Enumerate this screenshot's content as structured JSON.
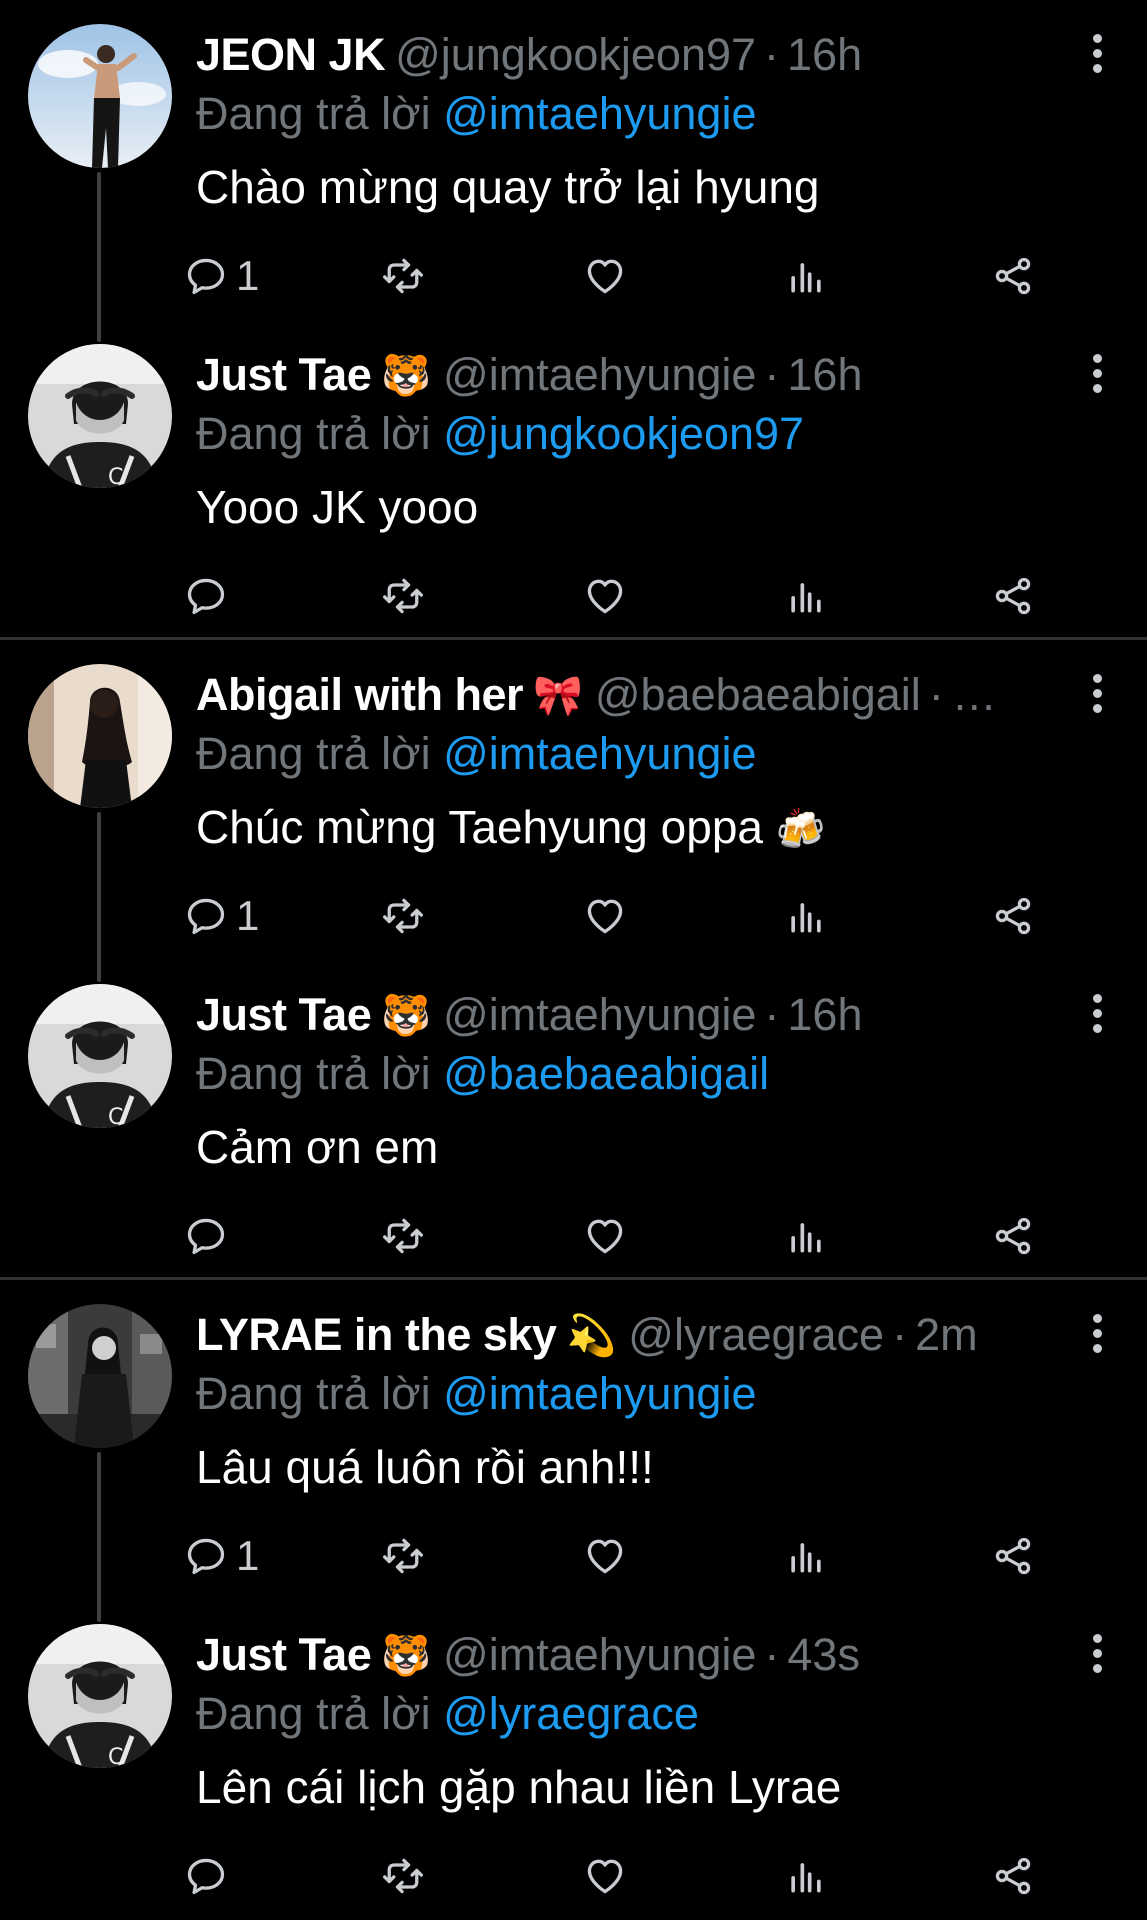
{
  "reply_label": "Đang trả lời",
  "threads": [
    {
      "tweets": [
        {
          "name": "JEON JK",
          "emoji": "",
          "handle": "@jungkookjeon97",
          "time": "16h",
          "reply_to": "@imtaehyungie",
          "text": "Chào mừng quay trở lại hyung",
          "text_emoji": "",
          "replies": "1",
          "avatar": "sky"
        },
        {
          "name": "Just Tae",
          "emoji": "🐯",
          "handle": "@imtaehyungie",
          "time": "16h",
          "reply_to": "@jungkookjeon97",
          "text": "Yooo JK yooo",
          "text_emoji": "",
          "replies": "",
          "avatar": "bw"
        }
      ]
    },
    {
      "tweets": [
        {
          "name": "Abigail with her",
          "emoji": "🎀",
          "handle": "@baebaeabigail",
          "time": "…",
          "reply_to": "@imtaehyungie",
          "text": "Chúc mừng Taehyung oppa",
          "text_emoji": "🍻",
          "replies": "1",
          "avatar": "warm"
        },
        {
          "name": "Just Tae",
          "emoji": "🐯",
          "handle": "@imtaehyungie",
          "time": "16h",
          "reply_to": "@baebaeabigail",
          "text": "Cảm ơn em",
          "text_emoji": "",
          "replies": "",
          "avatar": "bw"
        }
      ]
    },
    {
      "tweets": [
        {
          "name": "LYRAE in the sky",
          "emoji": "💫",
          "handle": "@lyraegrace",
          "time": "2m",
          "reply_to": "@imtaehyungie",
          "text": "Lâu quá luôn rồi anh!!!",
          "text_emoji": "",
          "replies": "1",
          "avatar": "street"
        },
        {
          "name": "Just Tae",
          "emoji": "🐯",
          "handle": "@imtaehyungie",
          "time": "43s",
          "reply_to": "@lyraegrace",
          "text": "Lên cái lịch gặp nhau liền Lyrae",
          "text_emoji": "",
          "replies": "",
          "avatar": "bw"
        }
      ]
    }
  ],
  "colors": {
    "background": "#000000",
    "muted": "#71767b",
    "link": "#1d9bf0",
    "divider": "#2f3336",
    "icon": "#c9cdd1"
  },
  "icons": [
    "reply-icon",
    "retweet-icon",
    "like-icon",
    "views-icon",
    "share-icon",
    "more-icon"
  ]
}
